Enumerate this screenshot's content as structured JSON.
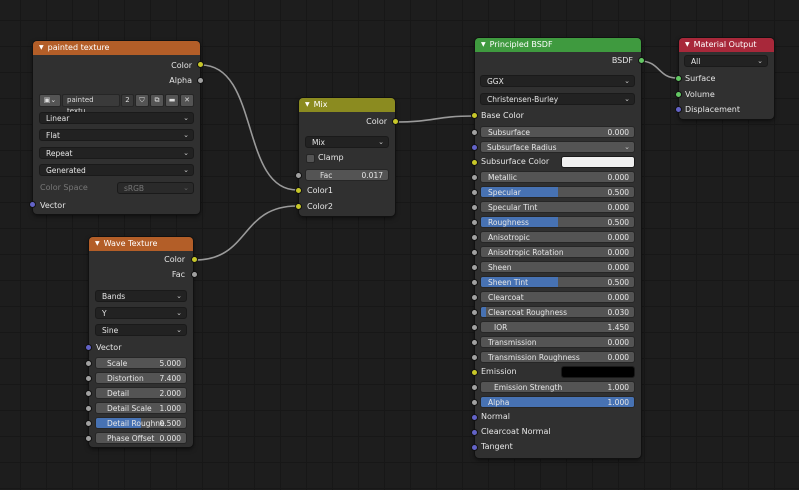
{
  "colors": {
    "background": "#1d1d1d",
    "node_body": "#303030",
    "texture_header": "#b35e28",
    "mix_header": "#8b8b20",
    "shader_header": "#3f9a3f",
    "output_header": "#a8283a",
    "socket_color": "#c7c729",
    "socket_float": "#a1a1a1",
    "socket_vector": "#6363c7",
    "socket_shader": "#63c763",
    "slider_fill": "#4772b3",
    "link": "#9a9a9a"
  },
  "painted_texture": {
    "title": "painted texture",
    "outputs": {
      "color": "Color",
      "alpha": "Alpha"
    },
    "image_name": "painted textu...",
    "users": "2",
    "interpolation": "Linear",
    "projection": "Flat",
    "extension": "Repeat",
    "source": "Generated",
    "color_space_label": "Color Space",
    "color_space_value": "sRGB",
    "input_vector": "Vector"
  },
  "wave_texture": {
    "title": "Wave Texture",
    "outputs": {
      "color": "Color",
      "fac": "Fac"
    },
    "wave_type": "Bands",
    "direction": "Y",
    "profile": "Sine",
    "input_vector": "Vector",
    "fields": [
      {
        "label": "Scale",
        "value": "5.000",
        "fill": 0
      },
      {
        "label": "Distortion",
        "value": "7.400",
        "fill": 0
      },
      {
        "label": "Detail",
        "value": "2.000",
        "fill": 0
      },
      {
        "label": "Detail Scale",
        "value": "1.000",
        "fill": 0
      },
      {
        "label": "Detail Roughne",
        "value": "0.500",
        "fill": 0.5
      },
      {
        "label": "Phase Offset",
        "value": "0.000",
        "fill": 0
      }
    ]
  },
  "mix": {
    "title": "Mix",
    "output_color": "Color",
    "blend_mode": "Mix",
    "clamp_label": "Clamp",
    "fac_label": "Fac",
    "fac_value": "0.017",
    "input_color1": "Color1",
    "input_color2": "Color2"
  },
  "principled": {
    "title": "Principled BSDF",
    "output_bsdf": "BSDF",
    "distribution": "GGX",
    "subsurface_method": "Christensen-Burley",
    "base_color_label": "Base Color",
    "fields": [
      {
        "label": "Subsurface",
        "value": "0.000",
        "fill": 0,
        "socket": "grey"
      },
      {
        "label": "Subsurface Radius",
        "value": "",
        "fill": 0,
        "socket": "blue",
        "dropdown": true
      },
      {
        "label": "Subsurface Color",
        "value": "",
        "fill": 0,
        "socket": "yellow",
        "swatch": "#f0f0f0"
      },
      {
        "label": "Metallic",
        "value": "0.000",
        "fill": 0,
        "socket": "grey"
      },
      {
        "label": "Specular",
        "value": "0.500",
        "fill": 0.5,
        "socket": "grey"
      },
      {
        "label": "Specular Tint",
        "value": "0.000",
        "fill": 0,
        "socket": "grey"
      },
      {
        "label": "Roughness",
        "value": "0.500",
        "fill": 0.5,
        "socket": "grey"
      },
      {
        "label": "Anisotropic",
        "value": "0.000",
        "fill": 0,
        "socket": "grey"
      },
      {
        "label": "Anisotropic Rotation",
        "value": "0.000",
        "fill": 0,
        "socket": "grey"
      },
      {
        "label": "Sheen",
        "value": "0.000",
        "fill": 0,
        "socket": "grey"
      },
      {
        "label": "Sheen Tint",
        "value": "0.500",
        "fill": 0.5,
        "socket": "grey"
      },
      {
        "label": "Clearcoat",
        "value": "0.000",
        "fill": 0,
        "socket": "grey"
      },
      {
        "label": "Clearcoat Roughness",
        "value": "0.030",
        "fill": 0.03,
        "socket": "grey"
      },
      {
        "label": "IOR",
        "value": "1.450",
        "fill": 0,
        "socket": "grey",
        "indent": true
      },
      {
        "label": "Transmission",
        "value": "0.000",
        "fill": 0,
        "socket": "grey"
      },
      {
        "label": "Transmission Roughness",
        "value": "0.000",
        "fill": 0,
        "socket": "grey"
      },
      {
        "label": "Emission",
        "value": "",
        "fill": 0,
        "socket": "yellow",
        "swatch": "#000000"
      },
      {
        "label": "Emission Strength",
        "value": "1.000",
        "fill": 0,
        "socket": "grey",
        "indent": true
      },
      {
        "label": "Alpha",
        "value": "1.000",
        "fill": 1,
        "socket": "grey"
      }
    ],
    "vector_inputs": [
      "Normal",
      "Clearcoat Normal",
      "Tangent"
    ]
  },
  "material_output": {
    "title": "Material Output",
    "target": "All",
    "inputs": [
      "Surface",
      "Volume",
      "Displacement"
    ]
  }
}
